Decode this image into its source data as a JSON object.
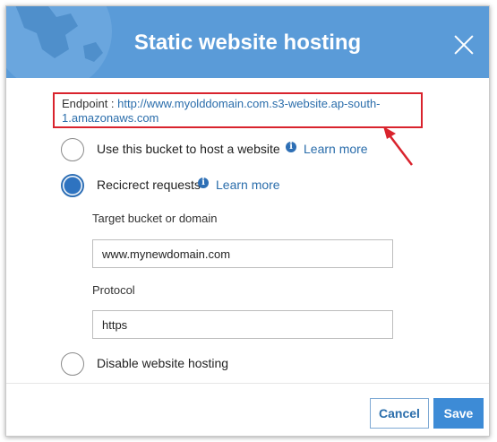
{
  "dialog": {
    "title": "Static website hosting",
    "header_color": "#5a9bd8",
    "close_icon": "close-icon"
  },
  "endpoint": {
    "label": "Endpoint :",
    "url_line1": "http://www.myolddomain.com.s3-website.ap-south-",
    "url_line2": "1.amazonaws.com",
    "highlight_color": "#d9232d"
  },
  "options": {
    "host_website": {
      "label": "Use this bucket to host a website",
      "learn_more": "Learn more",
      "selected": false
    },
    "redirect": {
      "label": "Recicrect requests",
      "learn_more": "Learn more",
      "selected": true
    },
    "disable": {
      "label": "Disable website hosting",
      "selected": false
    }
  },
  "redirect_fields": {
    "target_label": "Target bucket or domain",
    "target_value": "www.mynewdomain.com",
    "protocol_label": "Protocol",
    "protocol_value": "https"
  },
  "footer": {
    "cancel_label": "Cancel",
    "save_label": "Save",
    "accent_color": "#3d8bd6"
  }
}
